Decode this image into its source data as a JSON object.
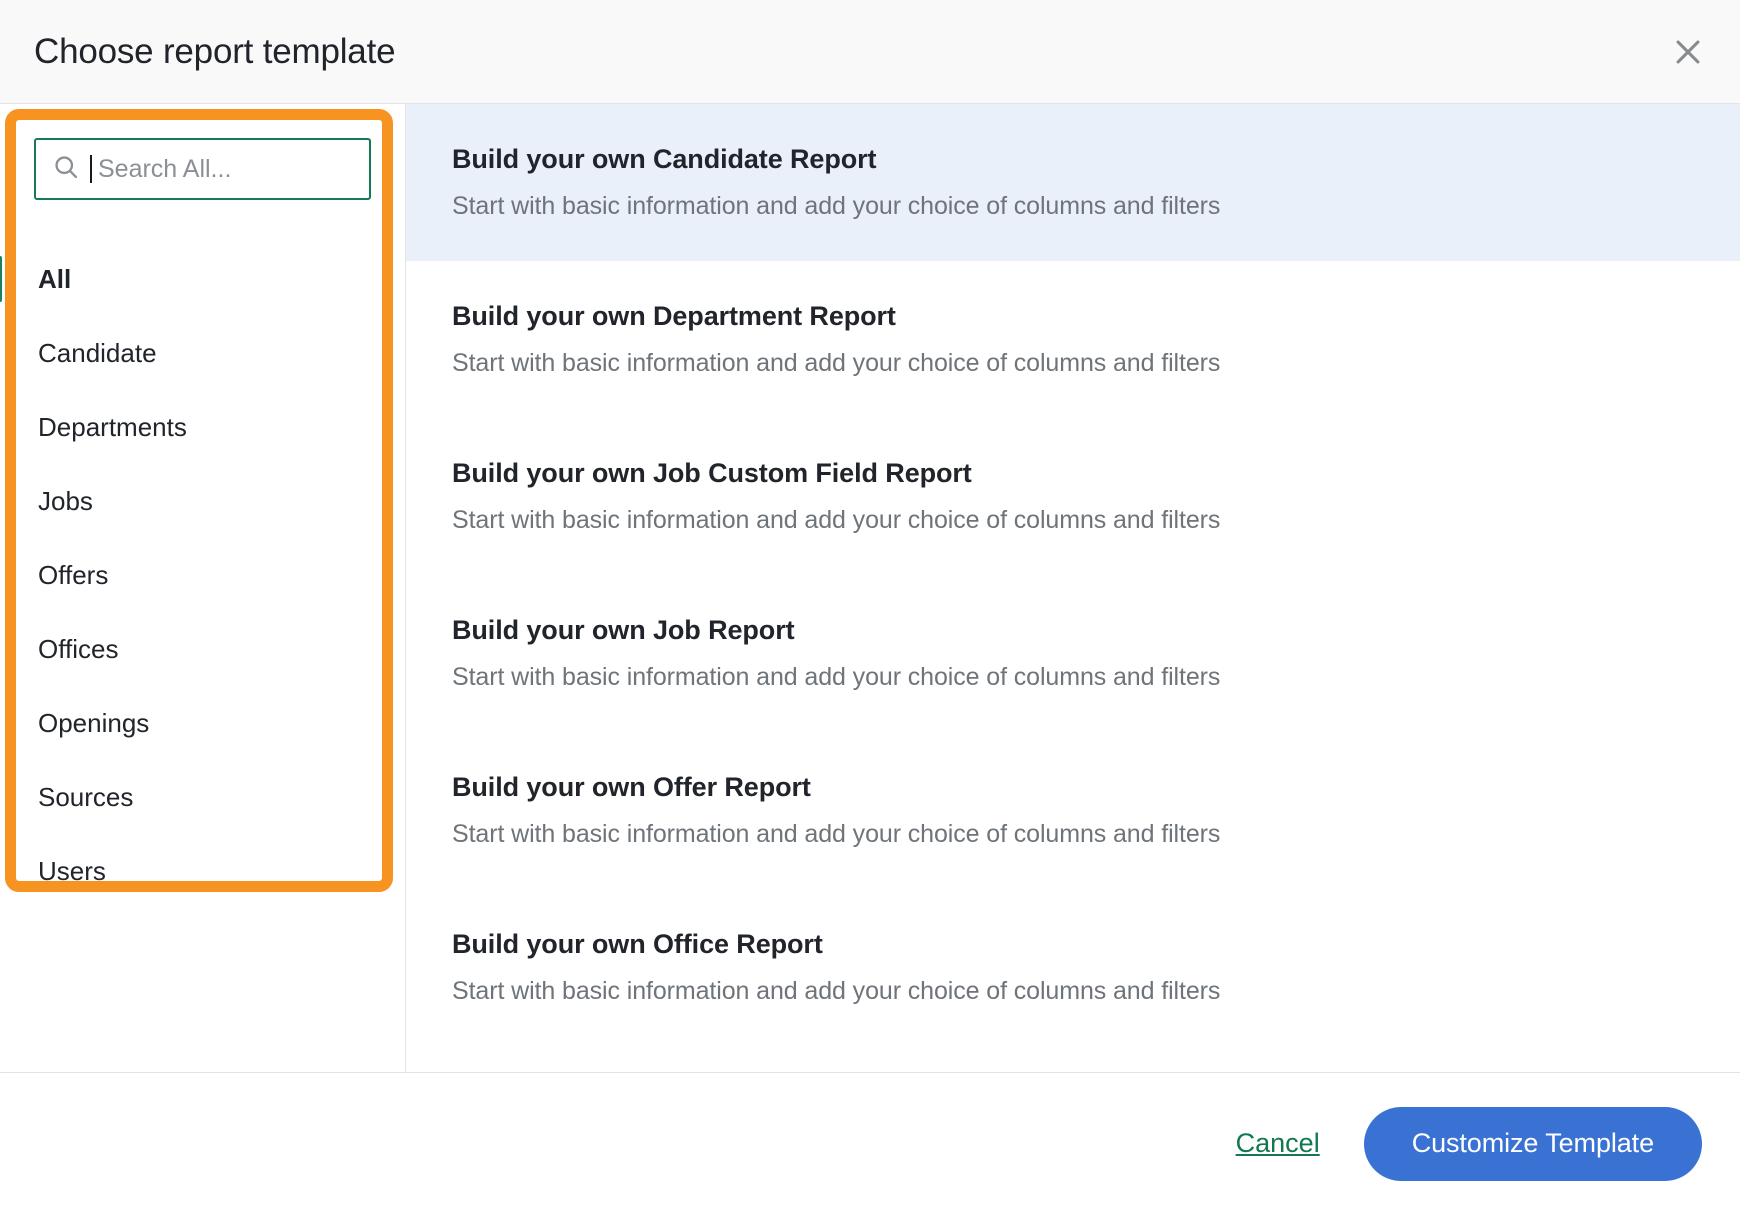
{
  "header": {
    "title": "Choose report template",
    "close_icon": "close-icon"
  },
  "sidebar": {
    "search": {
      "icon": "search-icon",
      "placeholder": "Search All...",
      "value": ""
    },
    "items": [
      {
        "label": "All",
        "selected": true
      },
      {
        "label": "Candidate",
        "selected": false
      },
      {
        "label": "Departments",
        "selected": false
      },
      {
        "label": "Jobs",
        "selected": false
      },
      {
        "label": "Offers",
        "selected": false
      },
      {
        "label": "Offices",
        "selected": false
      },
      {
        "label": "Openings",
        "selected": false
      },
      {
        "label": "Sources",
        "selected": false
      },
      {
        "label": "Users",
        "selected": false
      }
    ]
  },
  "templates": [
    {
      "name": "Build your own Candidate Report",
      "description": "Start with basic information and add your choice of columns and filters",
      "active": true
    },
    {
      "name": "Build your own Department Report",
      "description": "Start with basic information and add your choice of columns and filters",
      "active": false
    },
    {
      "name": "Build your own Job Custom Field Report",
      "description": "Start with basic information and add your choice of columns and filters",
      "active": false
    },
    {
      "name": "Build your own Job Report",
      "description": "Start with basic information and add your choice of columns and filters",
      "active": false
    },
    {
      "name": "Build your own Offer Report",
      "description": "Start with basic information and add your choice of columns and filters",
      "active": false
    },
    {
      "name": "Build your own Office Report",
      "description": "Start with basic information and add your choice of columns and filters",
      "active": false
    }
  ],
  "footer": {
    "cancel_label": "Cancel",
    "primary_label": "Customize Template"
  },
  "colors": {
    "accent_blue": "#3a72d4",
    "accent_green": "#12784f",
    "search_border_green": "#167a52",
    "selected_row_blue": "#e9f0fa",
    "annotation_orange": "#f79421",
    "header_bg": "#f9f9fa",
    "divider": "#e3e4e8",
    "text_primary": "#21252b",
    "text_secondary": "#6e7479"
  }
}
